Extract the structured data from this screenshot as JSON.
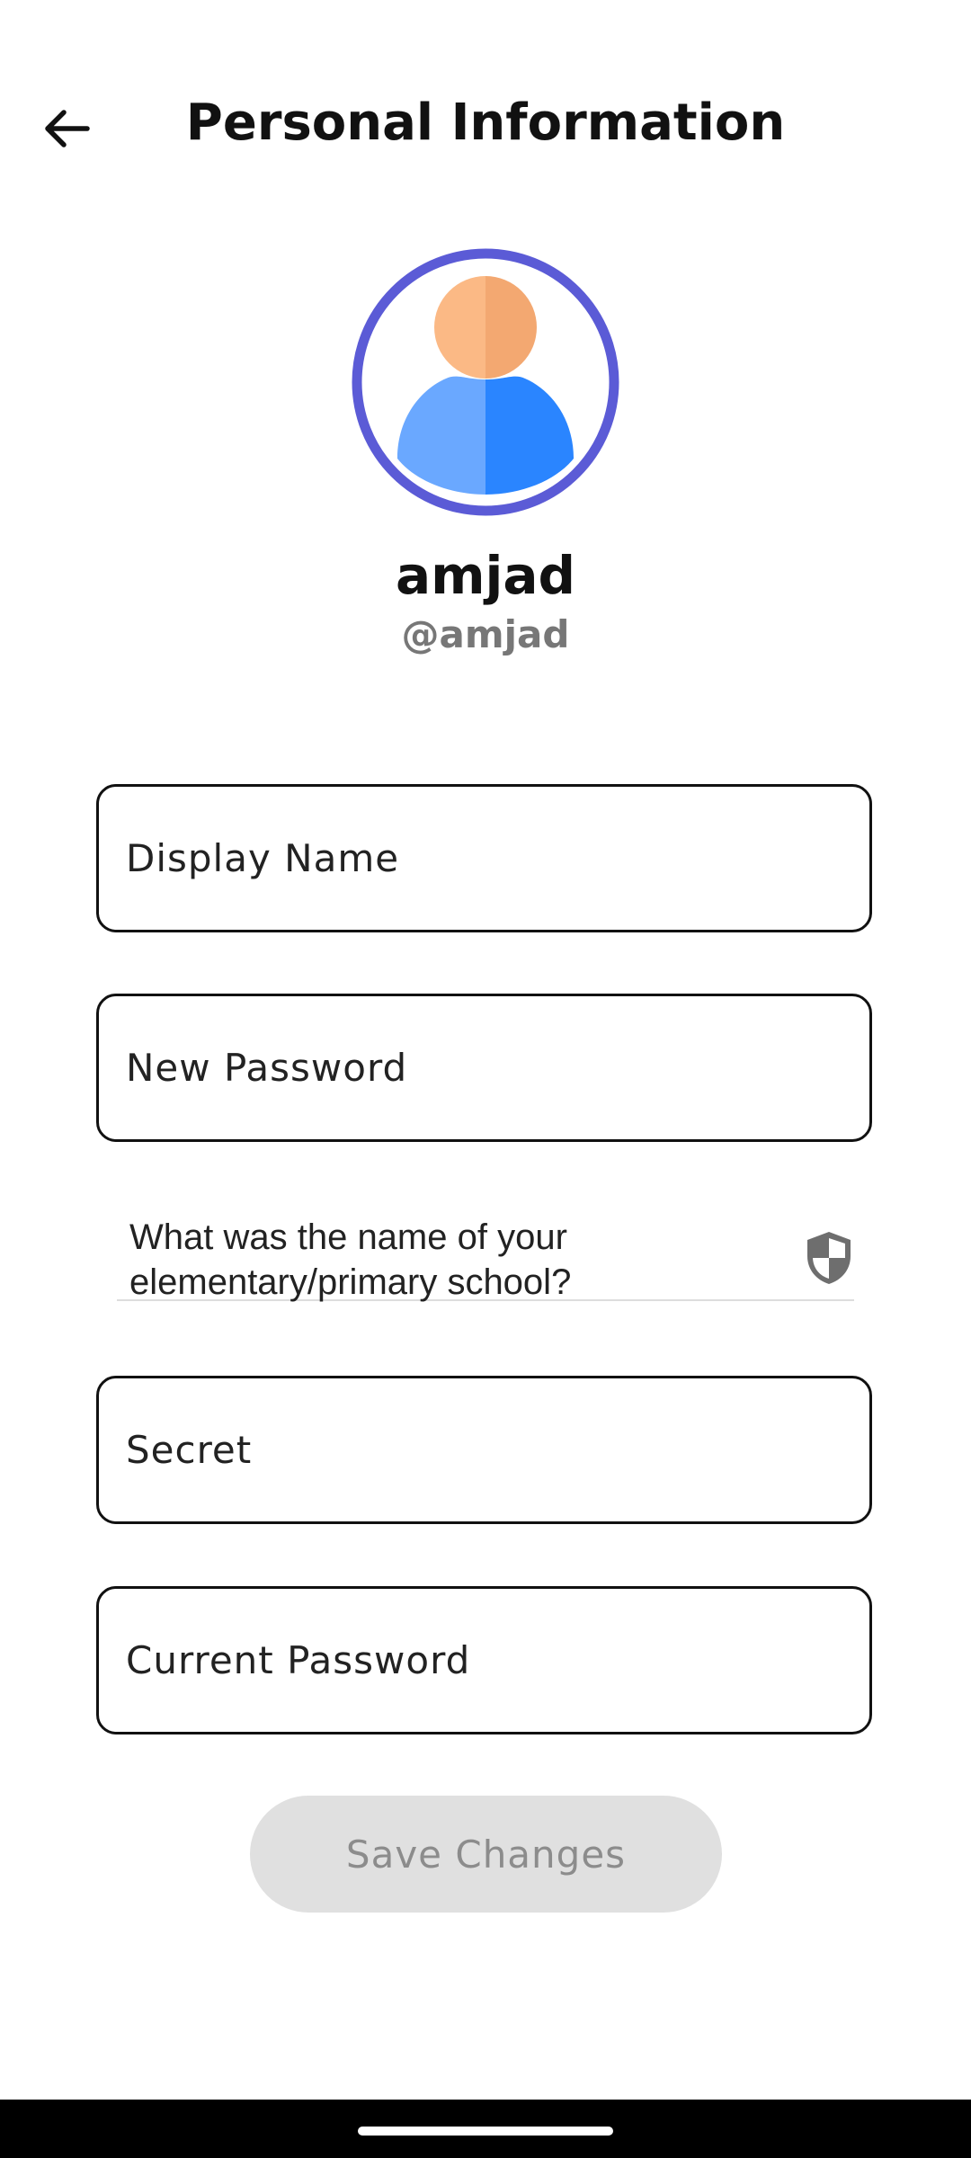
{
  "header": {
    "title": "Personal Information",
    "back_icon": "arrow-left-icon"
  },
  "profile": {
    "name": "amjad",
    "handle": "@amjad",
    "avatar_icon": "user-avatar-icon",
    "avatar_ring_color": "#5B5BD6"
  },
  "form": {
    "display_name_placeholder": "Display Name",
    "new_password_placeholder": "New Password",
    "security_question": "What was the name of your elementary/primary school?",
    "security_icon": "shield-icon",
    "secret_placeholder": "Secret",
    "current_password_placeholder": "Current Password",
    "save_label": "Save Changes"
  }
}
